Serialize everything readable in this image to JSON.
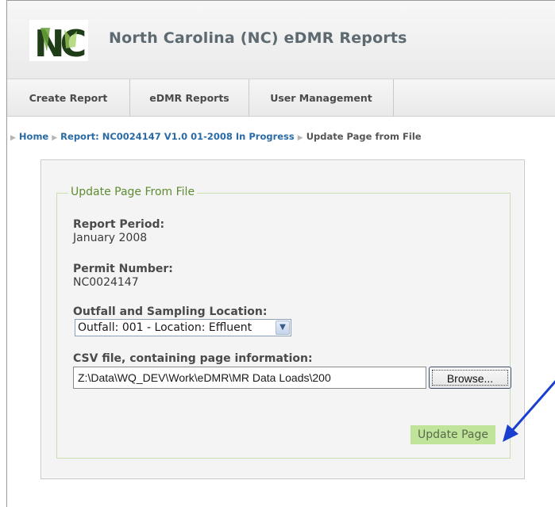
{
  "header": {
    "logo_text": "NC",
    "title": "North Carolina (NC) eDMR Reports"
  },
  "nav": {
    "tabs": [
      {
        "label": "Create Report"
      },
      {
        "label": "eDMR Reports"
      },
      {
        "label": "User Management"
      }
    ]
  },
  "breadcrumb": {
    "items": [
      {
        "label": "Home"
      },
      {
        "label": "Report: NC0024147 V1.0 01-2008 In Progress"
      },
      {
        "label": "Update Page from File"
      }
    ]
  },
  "form": {
    "legend": "Update Page From File",
    "report_period_label": "Report Period:",
    "report_period_value": "January 2008",
    "permit_number_label": "Permit Number:",
    "permit_number_value": "NC0024147",
    "outfall_label": "Outfall and Sampling Location:",
    "outfall_selected": "Outfall: 001 - Location: Effluent",
    "csv_label": "CSV file, containing page information:",
    "csv_value": "Z:\\Data\\WQ_DEV\\Work\\eDMR\\MR Data Loads\\200",
    "browse_label": "Browse...",
    "submit_label": "Update Page"
  },
  "colors": {
    "legend_green": "#5e8c30",
    "button_green": "#bfe49a",
    "link_blue": "#2a6aa5",
    "annotation_arrow": "#1a3fd0"
  },
  "icons": {
    "logo": "nc-logo-icon",
    "dropdown": "chevron-down-icon",
    "breadcrumb_separator": "triangle-right-icon",
    "annotation": "arrow-pointer-icon"
  }
}
